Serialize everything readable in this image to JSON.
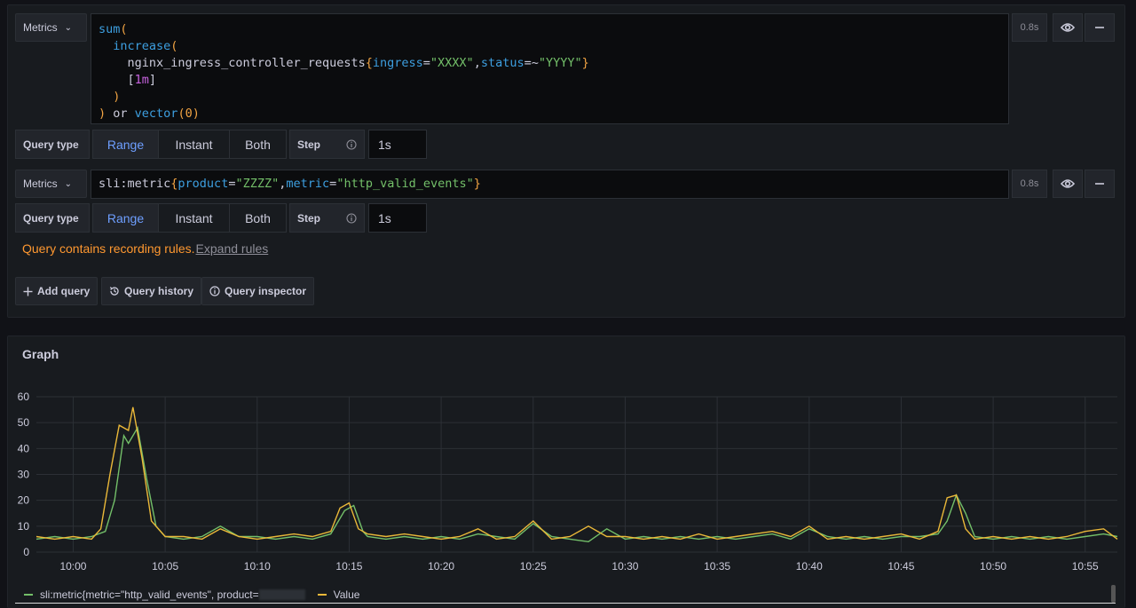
{
  "queries": [
    {
      "type_button": "Metrics",
      "time": "0.8s",
      "query_type_label": "Query type",
      "query_types": [
        "Range",
        "Instant",
        "Both"
      ],
      "active_type": "Range",
      "step_label": "Step",
      "step_value": "1s"
    },
    {
      "type_button": "Metrics",
      "time": "0.8s",
      "query_type_label": "Query type",
      "query_types": [
        "Range",
        "Instant",
        "Both"
      ],
      "active_type": "Range",
      "step_label": "Step",
      "step_value": "1s"
    }
  ],
  "query1_code": {
    "l1_fn": "sum",
    "l1_br": "(",
    "l2_fn": "increase",
    "l2_br": "(",
    "l3_metric": "nginx_ingress_controller_requests",
    "l3_lb": "{",
    "l3_k1": "ingress",
    "l3_eq1": "=",
    "l3_v1": "\"XXXX\"",
    "l3_comma": ",",
    "l3_k2": "status",
    "l3_eq2": "=~",
    "l3_v2": "\"YYYY\"",
    "l3_rb": "}",
    "l4_open": "[",
    "l4_dur": "1m",
    "l4_close": "]",
    "l5_br": ")",
    "l6_br": ")",
    "l6_or": " or ",
    "l6_fn": "vector",
    "l6_open": "(",
    "l6_num": "0",
    "l6_close": ")"
  },
  "query2_code": {
    "metric": "sli:metric",
    "lb": "{",
    "k1": "product",
    "eq1": "=",
    "v1": "\"ZZZZ\"",
    "comma": ",",
    "k2": "metric",
    "eq2": "=",
    "v2": "\"http_valid_events\"",
    "rb": "}"
  },
  "warning": {
    "text": "Query contains recording rules.",
    "link": "Expand rules"
  },
  "actions": {
    "add_query": "Add query",
    "history": "Query history",
    "inspector": "Query inspector"
  },
  "graph": {
    "title": "Graph",
    "legend": [
      {
        "label": "sli:metric{metric=\"http_valid_events\", product=",
        "color": "#73bf69"
      },
      {
        "label": "Value",
        "color": "#eab839"
      }
    ]
  },
  "chart_data": {
    "type": "line",
    "ylim": [
      0,
      60
    ],
    "yticks": [
      0,
      10,
      20,
      30,
      40,
      50,
      60
    ],
    "xlim": [
      "09:58",
      "10:56:45"
    ],
    "xticks": [
      "10:00",
      "10:05",
      "10:10",
      "10:15",
      "10:20",
      "10:25",
      "10:30",
      "10:35",
      "10:40",
      "10:45",
      "10:50",
      "10:55"
    ],
    "grid": true,
    "series": [
      {
        "name": "sli:metric{metric=\"http_valid_events\", product=",
        "color": "#73bf69",
        "points": [
          [
            "09:58",
            5
          ],
          [
            "09:59",
            6
          ],
          [
            "10:00",
            5
          ],
          [
            "10:01",
            6
          ],
          [
            "10:01:45",
            8
          ],
          [
            "10:02:15",
            20
          ],
          [
            "10:02:45",
            45
          ],
          [
            "10:03",
            42
          ],
          [
            "10:03:30",
            48
          ],
          [
            "10:04",
            28
          ],
          [
            "10:04:30",
            10
          ],
          [
            "10:05",
            6
          ],
          [
            "10:06",
            5
          ],
          [
            "10:07",
            6
          ],
          [
            "10:08",
            10
          ],
          [
            "10:09",
            6
          ],
          [
            "10:10",
            6
          ],
          [
            "10:11",
            5
          ],
          [
            "10:12",
            6
          ],
          [
            "10:13",
            5
          ],
          [
            "10:14",
            7
          ],
          [
            "10:14:45",
            16
          ],
          [
            "10:15:15",
            18
          ],
          [
            "10:15:45",
            8
          ],
          [
            "10:16",
            6
          ],
          [
            "10:17",
            5
          ],
          [
            "10:18",
            6
          ],
          [
            "10:19",
            5
          ],
          [
            "10:20",
            6
          ],
          [
            "10:21",
            5
          ],
          [
            "10:22",
            7
          ],
          [
            "10:23",
            6
          ],
          [
            "10:24",
            5
          ],
          [
            "10:25",
            11
          ],
          [
            "10:26",
            6
          ],
          [
            "10:27",
            5
          ],
          [
            "10:28",
            4
          ],
          [
            "10:29",
            9
          ],
          [
            "10:30",
            5
          ],
          [
            "10:31",
            6
          ],
          [
            "10:32",
            5
          ],
          [
            "10:33",
            6
          ],
          [
            "10:34",
            5
          ],
          [
            "10:35",
            6
          ],
          [
            "10:36",
            5
          ],
          [
            "10:37",
            6
          ],
          [
            "10:38",
            7
          ],
          [
            "10:39",
            5
          ],
          [
            "10:40",
            9
          ],
          [
            "10:41",
            6
          ],
          [
            "10:42",
            5
          ],
          [
            "10:43",
            6
          ],
          [
            "10:44",
            5
          ],
          [
            "10:45",
            6
          ],
          [
            "10:46",
            6
          ],
          [
            "10:47",
            7
          ],
          [
            "10:47:30",
            12
          ],
          [
            "10:48",
            22
          ],
          [
            "10:48:30",
            15
          ],
          [
            "10:49",
            6
          ],
          [
            "10:50",
            5
          ],
          [
            "10:51",
            6
          ],
          [
            "10:52",
            5
          ],
          [
            "10:53",
            6
          ],
          [
            "10:54",
            5
          ],
          [
            "10:55",
            6
          ],
          [
            "10:56",
            7
          ],
          [
            "10:56:45",
            6
          ]
        ]
      },
      {
        "name": "Value",
        "color": "#eab839",
        "points": [
          [
            "09:58",
            6
          ],
          [
            "09:59",
            5
          ],
          [
            "10:00",
            6
          ],
          [
            "10:01",
            5
          ],
          [
            "10:01:30",
            9
          ],
          [
            "10:02",
            30
          ],
          [
            "10:02:30",
            49
          ],
          [
            "10:03",
            47
          ],
          [
            "10:03:15",
            56
          ],
          [
            "10:03:45",
            36
          ],
          [
            "10:04:15",
            12
          ],
          [
            "10:05",
            6
          ],
          [
            "10:06",
            6
          ],
          [
            "10:07",
            5
          ],
          [
            "10:08",
            9
          ],
          [
            "10:09",
            6
          ],
          [
            "10:10",
            5
          ],
          [
            "10:11",
            6
          ],
          [
            "10:12",
            7
          ],
          [
            "10:13",
            6
          ],
          [
            "10:14",
            8
          ],
          [
            "10:14:30",
            17
          ],
          [
            "10:15",
            19
          ],
          [
            "10:15:30",
            9
          ],
          [
            "10:16",
            7
          ],
          [
            "10:17",
            6
          ],
          [
            "10:18",
            7
          ],
          [
            "10:19",
            6
          ],
          [
            "10:20",
            5
          ],
          [
            "10:21",
            6
          ],
          [
            "10:22",
            9
          ],
          [
            "10:23",
            5
          ],
          [
            "10:24",
            6
          ],
          [
            "10:25",
            12
          ],
          [
            "10:26",
            5
          ],
          [
            "10:27",
            6
          ],
          [
            "10:28",
            10
          ],
          [
            "10:29",
            6
          ],
          [
            "10:30",
            6
          ],
          [
            "10:31",
            5
          ],
          [
            "10:32",
            6
          ],
          [
            "10:33",
            5
          ],
          [
            "10:34",
            7
          ],
          [
            "10:35",
            5
          ],
          [
            "10:36",
            6
          ],
          [
            "10:37",
            7
          ],
          [
            "10:38",
            8
          ],
          [
            "10:39",
            6
          ],
          [
            "10:40",
            10
          ],
          [
            "10:41",
            5
          ],
          [
            "10:42",
            6
          ],
          [
            "10:43",
            5
          ],
          [
            "10:44",
            6
          ],
          [
            "10:45",
            7
          ],
          [
            "10:46",
            5
          ],
          [
            "10:47",
            8
          ],
          [
            "10:47:30",
            21
          ],
          [
            "10:48",
            22
          ],
          [
            "10:48:30",
            9
          ],
          [
            "10:49",
            5
          ],
          [
            "10:50",
            6
          ],
          [
            "10:51",
            5
          ],
          [
            "10:52",
            6
          ],
          [
            "10:53",
            5
          ],
          [
            "10:54",
            6
          ],
          [
            "10:55",
            8
          ],
          [
            "10:56",
            9
          ],
          [
            "10:56:45",
            5
          ]
        ]
      }
    ]
  }
}
